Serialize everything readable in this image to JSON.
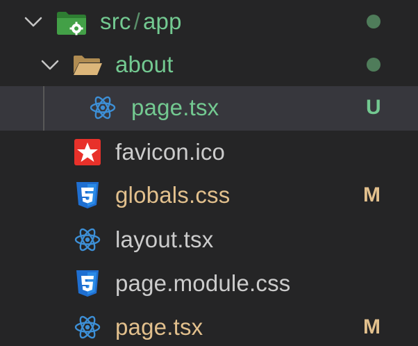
{
  "explorer": {
    "rows": [
      {
        "name_parts": [
          "src",
          "/",
          "app"
        ],
        "icon": "folder-app-icon",
        "expanded": true,
        "status": "modified-dot"
      },
      {
        "name": "about",
        "icon": "folder-open-icon",
        "expanded": true,
        "status": "modified-dot"
      },
      {
        "name": "page.tsx",
        "icon": "react-icon",
        "badge": "U",
        "selected": true
      },
      {
        "name": "favicon.ico",
        "icon": "favicon-star-icon"
      },
      {
        "name": "globals.css",
        "icon": "css3-icon",
        "badge": "M"
      },
      {
        "name": "layout.tsx",
        "icon": "react-icon"
      },
      {
        "name": "page.module.css",
        "icon": "css3-icon"
      },
      {
        "name": "page.tsx",
        "icon": "react-icon",
        "badge": "M"
      }
    ]
  },
  "colors": {
    "background": "#252526",
    "selected_row": "#37373d",
    "untracked_green": "#73c991",
    "modified_yellow": "#e2c08d",
    "default_text": "#cccccc",
    "react_blue": "#3d8fd6",
    "css_blue": "#1f6fd1",
    "favicon_red": "#e8312a"
  }
}
